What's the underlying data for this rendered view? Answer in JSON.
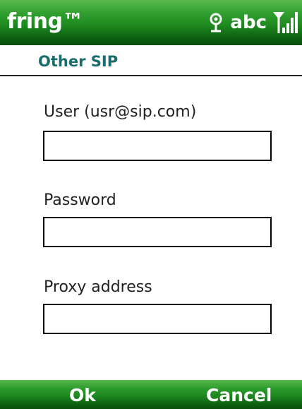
{
  "status_bar": {
    "app_title": "fring™",
    "icons": [
      "connectivity-icon",
      "signal-strength-icon"
    ],
    "input_mode": "abc"
  },
  "header": {
    "title": "Other SIP"
  },
  "form": {
    "user": {
      "label": "User (usr@sip.com)",
      "value": "",
      "placeholder": ""
    },
    "password": {
      "label": "Password",
      "value": "",
      "placeholder": ""
    },
    "proxy": {
      "label": "Proxy address",
      "value": "",
      "placeholder": ""
    }
  },
  "softkeys": {
    "left": "Ok",
    "right": "Cancel"
  },
  "colors": {
    "bar_green": "#1f8a20",
    "title_teal": "#1b6d6d"
  }
}
